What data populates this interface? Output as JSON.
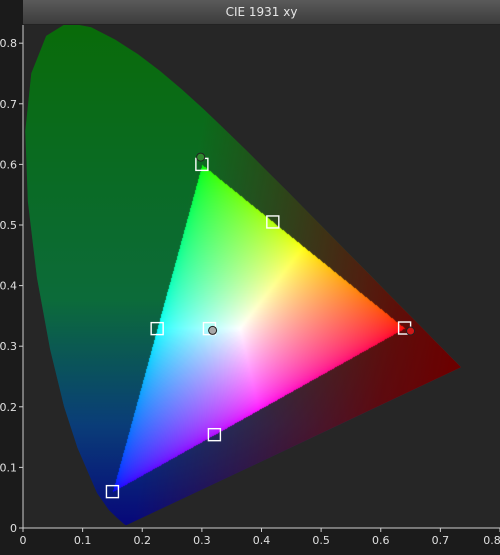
{
  "chart_data": {
    "type": "scatter",
    "title": "CIE 1931 xy",
    "xlim": [
      0,
      0.8
    ],
    "ylim": [
      0,
      0.83
    ],
    "x_ticks": [
      "0",
      "0.1",
      "0.2",
      "0.3",
      "0.4",
      "0.5",
      "0.6",
      "0.7",
      "0.8"
    ],
    "y_ticks": [
      "0",
      "0.1",
      "0.2",
      "0.3",
      "0.4",
      "0.5",
      "0.6",
      "0.7",
      "0.8"
    ],
    "spectral_locus": [
      [
        0.1741,
        0.005
      ],
      [
        0.1738,
        0.0049
      ],
      [
        0.1733,
        0.0048
      ],
      [
        0.1726,
        0.0048
      ],
      [
        0.1714,
        0.0051
      ],
      [
        0.1689,
        0.0069
      ],
      [
        0.1644,
        0.0109
      ],
      [
        0.1566,
        0.0177
      ],
      [
        0.144,
        0.0297
      ],
      [
        0.1241,
        0.0578
      ],
      [
        0.0913,
        0.1327
      ],
      [
        0.0687,
        0.2007
      ],
      [
        0.0454,
        0.295
      ],
      [
        0.0235,
        0.4127
      ],
      [
        0.0082,
        0.5384
      ],
      [
        0.0039,
        0.6548
      ],
      [
        0.0139,
        0.7502
      ],
      [
        0.0389,
        0.812
      ],
      [
        0.0743,
        0.8338
      ],
      [
        0.1142,
        0.8262
      ],
      [
        0.1547,
        0.8059
      ],
      [
        0.1929,
        0.7816
      ],
      [
        0.2296,
        0.7543
      ],
      [
        0.2658,
        0.7243
      ],
      [
        0.3016,
        0.6923
      ],
      [
        0.3373,
        0.6589
      ],
      [
        0.3731,
        0.6245
      ],
      [
        0.4087,
        0.5896
      ],
      [
        0.4441,
        0.5547
      ],
      [
        0.4788,
        0.5202
      ],
      [
        0.5125,
        0.4866
      ],
      [
        0.5448,
        0.4544
      ],
      [
        0.5752,
        0.4242
      ],
      [
        0.6029,
        0.3965
      ],
      [
        0.627,
        0.3725
      ],
      [
        0.6482,
        0.3514
      ],
      [
        0.6658,
        0.334
      ],
      [
        0.6801,
        0.3197
      ],
      [
        0.6915,
        0.3083
      ],
      [
        0.7006,
        0.2993
      ],
      [
        0.7079,
        0.292
      ],
      [
        0.714,
        0.2859
      ],
      [
        0.719,
        0.2809
      ],
      [
        0.723,
        0.277
      ],
      [
        0.726,
        0.274
      ],
      [
        0.7283,
        0.2717
      ],
      [
        0.73,
        0.27
      ],
      [
        0.7311,
        0.2689
      ],
      [
        0.732,
        0.268
      ],
      [
        0.7327,
        0.2673
      ],
      [
        0.7334,
        0.2666
      ],
      [
        0.734,
        0.266
      ],
      [
        0.7344,
        0.2656
      ],
      [
        0.7346,
        0.2654
      ],
      [
        0.7347,
        0.2653
      ]
    ],
    "target_gamut": [
      [
        0.64,
        0.33
      ],
      [
        0.3,
        0.6
      ],
      [
        0.15,
        0.06
      ]
    ],
    "targets": [
      {
        "x": 0.64,
        "y": 0.33
      },
      {
        "x": 0.3,
        "y": 0.6
      },
      {
        "x": 0.15,
        "y": 0.06
      },
      {
        "x": 0.3127,
        "y": 0.329
      },
      {
        "x": 0.419,
        "y": 0.505
      },
      {
        "x": 0.225,
        "y": 0.329
      },
      {
        "x": 0.321,
        "y": 0.154
      }
    ],
    "measured": [
      {
        "x": 0.65,
        "y": 0.325,
        "color": "#d01818"
      },
      {
        "x": 0.298,
        "y": 0.612,
        "color": "#2e8a2e"
      },
      {
        "x": 0.318,
        "y": 0.326,
        "color": "#a8a8a8"
      }
    ],
    "colors": {
      "background": "#262626",
      "red": "#ff0000",
      "green": "#00ff00",
      "blue": "#0000ff",
      "locus_green": "#0c8a0c",
      "locus_blue": "#0a0a9c",
      "locus_red": "#8a0000"
    },
    "grid": false
  }
}
